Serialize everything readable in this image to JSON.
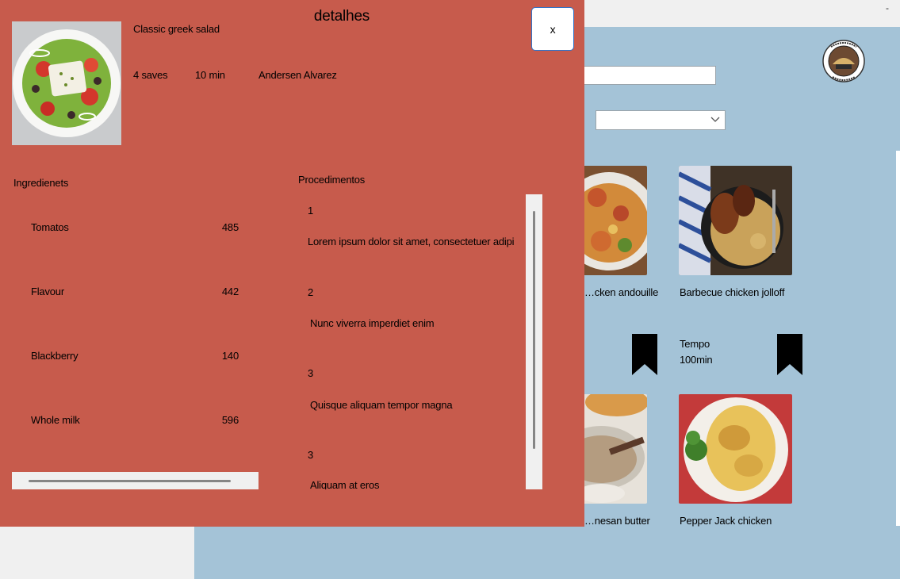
{
  "window": {
    "minimize_glyph": "-"
  },
  "background": {
    "search_value": "",
    "filter_selected": "",
    "logo": {
      "icon": "croissant-logo",
      "text_top": "BELLE CROISSANT",
      "text_bottom": "LYONNAIS"
    },
    "cards": [
      {
        "title": "…cken andouille",
        "icon": "recipe-photo"
      },
      {
        "title": "Barbecue chicken jolloff",
        "icon": "recipe-photo"
      },
      {
        "title": "…nesan butter",
        "icon": "recipe-photo"
      },
      {
        "title": "Pepper Jack chicken",
        "icon": "recipe-photo"
      }
    ],
    "tempo_label": "Tempo",
    "tempo_value": "100min",
    "bookmark_icon": "bookmark-icon"
  },
  "modal": {
    "title": "detalhes",
    "close_label": "x",
    "recipe": {
      "name": "Classic greek salad",
      "saves": "4 saves",
      "time": "10 min",
      "author": "Andersen Alvarez",
      "image_icon": "greek-salad-photo"
    },
    "ingredients": {
      "header": "Ingredienets",
      "items": [
        {
          "name": "Tomatos",
          "qty": "485"
        },
        {
          "name": "Flavour",
          "qty": "442"
        },
        {
          "name": "Blackberry",
          "qty": "140"
        },
        {
          "name": "Whole milk",
          "qty": "596"
        }
      ]
    },
    "procedures": {
      "header": "Procedimentos",
      "steps": [
        {
          "num": "1",
          "text": "Lorem ipsum dolor sit amet, consectetuer adipi"
        },
        {
          "num": "2",
          "text": "Nunc viverra imperdiet enim"
        },
        {
          "num": "3",
          "text": "Quisque aliquam tempor magna"
        },
        {
          "num": "3",
          "text": "Aliquam at eros"
        }
      ]
    }
  }
}
